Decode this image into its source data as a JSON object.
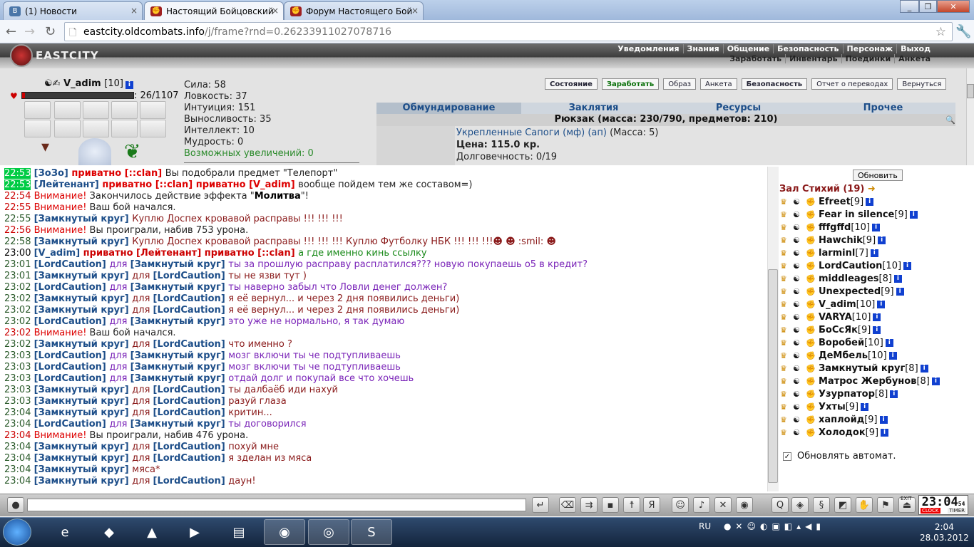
{
  "browser": {
    "tabs": [
      {
        "label": "(1) Новости",
        "color": "#4a76a8",
        "icon": "vk-icon"
      },
      {
        "label": "Настоящий Бойцовский К",
        "color": "#a02020",
        "icon": "fist-icon"
      },
      {
        "label": "Форум Настоящего Бойцо",
        "color": "#a02020",
        "icon": "fist-icon"
      }
    ],
    "url_host": "eastcity.oldcombats.info",
    "url_path": "/j/frame?rnd=0.26233911027078716"
  },
  "game": {
    "logo": "EASTCITY",
    "menu_top": [
      "Уведомления",
      "Знания",
      "Общение",
      "Безопасность",
      "Персонаж",
      "Выход"
    ],
    "menu_bottom": [
      "Заработать",
      "Инвентарь",
      "Поединки",
      "Анкета"
    ]
  },
  "character": {
    "name": "V_adim",
    "level": "[10]",
    "hp": ": 26/1107",
    "stats": [
      "Сила: 58",
      "Ловкость: 37",
      "Интуиция: 151",
      "Выносливость: 35",
      "Интеллект: 10",
      "Мудрость: 0"
    ],
    "upgrades": "Возможных увеличений: 0",
    "buttons": [
      "Состояние",
      "Заработать",
      "Образ",
      "Анкета",
      "Безопасность",
      "Отчет о переводах",
      "Вернуться"
    ]
  },
  "inventory": {
    "tabs": [
      "Обмундирование",
      "Заклятия",
      "Ресурсы",
      "Прочее"
    ],
    "summary": "Рюкзак (масса: 230/790, предметов: 210)",
    "item_name": "Укрепленные Сапоги (мф) (ап)",
    "item_mass": " (Масса: 5)",
    "item_price": "Цена: 115.0 кр.",
    "item_dur": "Долговечность: 0/19"
  },
  "chat": [
    {
      "time": "22:53",
      "tc": "hl",
      "parts": [
        [
          "nk",
          "[ЗоЗо] "
        ],
        [
          "pr",
          "приватно [::clan] "
        ],
        [
          "tx",
          "Вы подобрали предмет \"Телепорт\""
        ]
      ]
    },
    {
      "time": "22:53",
      "tc": "hl",
      "parts": [
        [
          "nk",
          "[Лейтенант] "
        ],
        [
          "pr",
          "приватно [::clan] приватно [V_adim] "
        ],
        [
          "tx",
          "вообще пойдем тем же составом=)"
        ]
      ]
    },
    {
      "time": "22:54",
      "tc": "r",
      "parts": [
        [
          "att",
          "Внимание! "
        ],
        [
          "tx",
          "Закончилось действие эффекта \""
        ],
        [
          "b",
          "Молитва"
        ],
        [
          "tx",
          "\"!"
        ]
      ]
    },
    {
      "time": "22:55",
      "tc": "r",
      "parts": [
        [
          "att",
          "Внимание! "
        ],
        [
          "tx",
          "Ваш бой начался."
        ]
      ]
    },
    {
      "time": "22:55",
      "tc": "n",
      "parts": [
        [
          "nk",
          "[Замкнутый круг] "
        ],
        [
          "tx m",
          "Куплю Доспех кровавой расправы !!! !!! !!!"
        ]
      ]
    },
    {
      "time": "22:56",
      "tc": "r",
      "parts": [
        [
          "att",
          "Внимание! "
        ],
        [
          "tx",
          "Вы проиграли, набив 753 урона."
        ]
      ]
    },
    {
      "time": "22:58",
      "tc": "n",
      "parts": [
        [
          "nk",
          "[Замкнутый круг] "
        ],
        [
          "tx m",
          "Куплю Доспех кровавой расправы !!! !!! !!! Куплю Футболку НБК !!! !!! !!!☻ ☻ :smil: ☻"
        ]
      ]
    },
    {
      "time": "23:00",
      "tc": "k",
      "parts": [
        [
          "nk",
          "[V_adim] "
        ],
        [
          "pv",
          "приватно [Лейтенант] приватно [::clan] "
        ],
        [
          "tx g",
          "а где именно кинь ссылку"
        ]
      ]
    },
    {
      "time": "23:01",
      "tc": "n",
      "parts": [
        [
          "nk",
          "[LordCaution] "
        ],
        [
          "tx v",
          "для "
        ],
        [
          "nk",
          "[Замкнутый круг] "
        ],
        [
          "tx v",
          "ты за прошлую расправу расплатился??? новую покупаешь о5 в кредит?"
        ]
      ]
    },
    {
      "time": "23:01",
      "tc": "n",
      "parts": [
        [
          "nk",
          "[Замкнутый круг] "
        ],
        [
          "tx m",
          "для "
        ],
        [
          "nk",
          "[LordCaution] "
        ],
        [
          "tx m",
          "ты не язви тут )"
        ]
      ]
    },
    {
      "time": "23:02",
      "tc": "n",
      "parts": [
        [
          "nk",
          "[LordCaution] "
        ],
        [
          "tx v",
          "для "
        ],
        [
          "nk",
          "[Замкнутый круг] "
        ],
        [
          "tx v",
          "ты наверно забыл что Ловли денег должен?"
        ]
      ]
    },
    {
      "time": "23:02",
      "tc": "n",
      "parts": [
        [
          "nk",
          "[Замкнутый круг] "
        ],
        [
          "tx m",
          "для "
        ],
        [
          "nk",
          "[LordCaution] "
        ],
        [
          "tx m",
          "я её вернул... и через 2 дня появились деньги)"
        ]
      ]
    },
    {
      "time": "23:02",
      "tc": "n",
      "parts": [
        [
          "nk",
          "[Замкнутый круг] "
        ],
        [
          "tx m",
          "для "
        ],
        [
          "nk",
          "[LordCaution] "
        ],
        [
          "tx m",
          "я её вернул... и через 2 дня появились деньги)"
        ]
      ]
    },
    {
      "time": "23:02",
      "tc": "n",
      "parts": [
        [
          "nk",
          "[LordCaution] "
        ],
        [
          "tx v",
          "для "
        ],
        [
          "nk",
          "[Замкнутый круг] "
        ],
        [
          "tx v",
          "это уже не нормально, я так думаю"
        ]
      ]
    },
    {
      "time": "23:02",
      "tc": "r",
      "parts": [
        [
          "att",
          "Внимание! "
        ],
        [
          "tx",
          "Ваш бой начался."
        ]
      ]
    },
    {
      "time": "23:02",
      "tc": "n",
      "parts": [
        [
          "nk",
          "[Замкнутый круг] "
        ],
        [
          "tx m",
          "для "
        ],
        [
          "nk",
          "[LordCaution] "
        ],
        [
          "tx m",
          "что именно ?"
        ]
      ]
    },
    {
      "time": "23:03",
      "tc": "n",
      "parts": [
        [
          "nk",
          "[LordCaution] "
        ],
        [
          "tx v",
          "для "
        ],
        [
          "nk",
          "[Замкнутый круг] "
        ],
        [
          "tx v",
          "мозг включи ты че подтупливаешь"
        ]
      ]
    },
    {
      "time": "23:03",
      "tc": "n",
      "parts": [
        [
          "nk",
          "[LordCaution] "
        ],
        [
          "tx v",
          "для "
        ],
        [
          "nk",
          "[Замкнутый круг] "
        ],
        [
          "tx v",
          "мозг включи ты че подтупливаешь"
        ]
      ]
    },
    {
      "time": "23:03",
      "tc": "n",
      "parts": [
        [
          "nk",
          "[LordCaution] "
        ],
        [
          "tx v",
          "для "
        ],
        [
          "nk",
          "[Замкнутый круг] "
        ],
        [
          "tx v",
          "отдай долг и покупай все что хочешь"
        ]
      ]
    },
    {
      "time": "23:03",
      "tc": "n",
      "parts": [
        [
          "nk",
          "[Замкнутый круг] "
        ],
        [
          "tx m",
          "для "
        ],
        [
          "nk",
          "[LordCaution] "
        ],
        [
          "tx m",
          "ты далбаёб иди нахуй"
        ]
      ]
    },
    {
      "time": "23:03",
      "tc": "n",
      "parts": [
        [
          "nk",
          "[Замкнутый круг] "
        ],
        [
          "tx m",
          "для "
        ],
        [
          "nk",
          "[LordCaution] "
        ],
        [
          "tx m",
          "разуй глаза"
        ]
      ]
    },
    {
      "time": "23:04",
      "tc": "n",
      "parts": [
        [
          "nk",
          "[Замкнутый круг] "
        ],
        [
          "tx m",
          "для "
        ],
        [
          "nk",
          "[LordCaution] "
        ],
        [
          "tx m",
          "критин..."
        ]
      ]
    },
    {
      "time": "23:04",
      "tc": "n",
      "parts": [
        [
          "nk",
          "[LordCaution] "
        ],
        [
          "tx v",
          "для "
        ],
        [
          "nk",
          "[Замкнутый круг] "
        ],
        [
          "tx v",
          "ты договорился"
        ]
      ]
    },
    {
      "time": "23:04",
      "tc": "r",
      "parts": [
        [
          "att",
          "Внимание! "
        ],
        [
          "tx",
          "Вы проиграли, набив 476 урона."
        ]
      ]
    },
    {
      "time": "23:04",
      "tc": "n",
      "parts": [
        [
          "nk",
          "[Замкнутый круг] "
        ],
        [
          "tx m",
          "для "
        ],
        [
          "nk",
          "[LordCaution] "
        ],
        [
          "tx m",
          "похуй мне"
        ]
      ]
    },
    {
      "time": "23:04",
      "tc": "n",
      "parts": [
        [
          "nk",
          "[Замкнутый круг] "
        ],
        [
          "tx m",
          "для "
        ],
        [
          "nk",
          "[LordCaution] "
        ],
        [
          "tx m",
          "я зделан из мяса"
        ]
      ]
    },
    {
      "time": "23:04",
      "tc": "n",
      "parts": [
        [
          "nk",
          "[Замкнутый круг] "
        ],
        [
          "tx m",
          "мяса*"
        ]
      ]
    },
    {
      "time": "23:04",
      "tc": "n",
      "parts": [
        [
          "nk",
          "[Замкнутый круг] "
        ],
        [
          "tx m",
          "для "
        ],
        [
          "nk",
          "[LordCaution] "
        ],
        [
          "tx m",
          "даун!"
        ]
      ]
    }
  ],
  "room": {
    "refresh": "Обновить",
    "title": "Зал Стихий (19)",
    "players": [
      [
        "Efreet",
        "[9]"
      ],
      [
        "Fear in silence",
        "[9]"
      ],
      [
        "fffgffd",
        "[10]"
      ],
      [
        "Hawchik",
        "[9]"
      ],
      [
        "larminl",
        "[7]"
      ],
      [
        "LordCaution",
        "[10]"
      ],
      [
        "middleages",
        "[8]"
      ],
      [
        "Unexpected",
        "[9]"
      ],
      [
        "V_adim",
        "[10]"
      ],
      [
        "VARYA",
        "[10]"
      ],
      [
        "БоСсЯк",
        "[9]"
      ],
      [
        "Воробей",
        "[10]"
      ],
      [
        "ДеМбель",
        "[10]"
      ],
      [
        "Замкнутый круг",
        "[8]"
      ],
      [
        "Матрос Жербунов",
        "[8]"
      ],
      [
        "Узурпатор",
        "[8]"
      ],
      [
        "Ухты",
        "[9]"
      ],
      [
        "хаплойд",
        "[9]"
      ],
      [
        "Холодок",
        "[9]"
      ]
    ],
    "auto": "Обновлять автомат."
  },
  "bottom": {
    "clock": "23:04",
    "clock_sec": "54",
    "clock_label": "CLOCK",
    "timer_label": "TIMER"
  },
  "taskbar": {
    "lang": "RU",
    "time": "2:04",
    "date": "28.03.2012"
  }
}
